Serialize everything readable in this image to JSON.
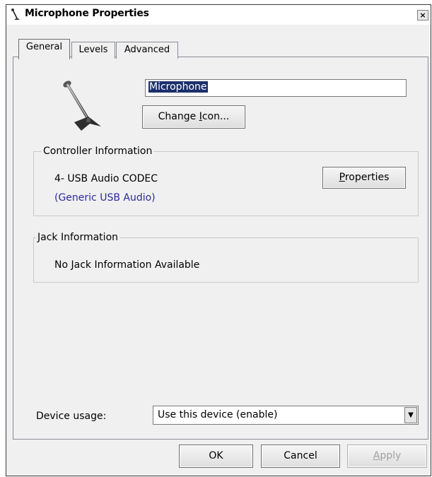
{
  "window": {
    "title": "Microphone Properties",
    "close_glyph": "×"
  },
  "tabs": [
    {
      "label": "General",
      "active": true
    },
    {
      "label": "Levels",
      "active": false
    },
    {
      "label": "Advanced",
      "active": false
    }
  ],
  "general": {
    "device_name": "Microphone",
    "change_icon_button": {
      "pre": "Change ",
      "mnemonic": "I",
      "post": "con..."
    },
    "controller_group": {
      "title": "Controller Information",
      "controller_name": "4- USB Audio CODEC",
      "controller_type": "(Generic USB Audio)",
      "properties_button": {
        "pre": "",
        "mnemonic": "P",
        "post": "roperties"
      }
    },
    "jack_group": {
      "title": "Jack Information",
      "message": "No Jack Information Available"
    },
    "device_usage": {
      "label": "Device usage:",
      "selected": "Use this device (enable)"
    }
  },
  "footer": {
    "ok_label": "OK",
    "cancel_label": "Cancel",
    "apply_button": {
      "pre": "",
      "mnemonic": "A",
      "post": "pply",
      "enabled": false
    }
  },
  "icons": {
    "title_icon": "microphone-icon",
    "device_icon": "microphone-icon",
    "dropdown_icon": "chevron-down-icon"
  },
  "colors": {
    "selection_bg": "#1b2f6b",
    "link_text": "#2a2a9a",
    "dialog_bg": "#f0f0f0",
    "disabled_text": "#a0a0a0"
  }
}
